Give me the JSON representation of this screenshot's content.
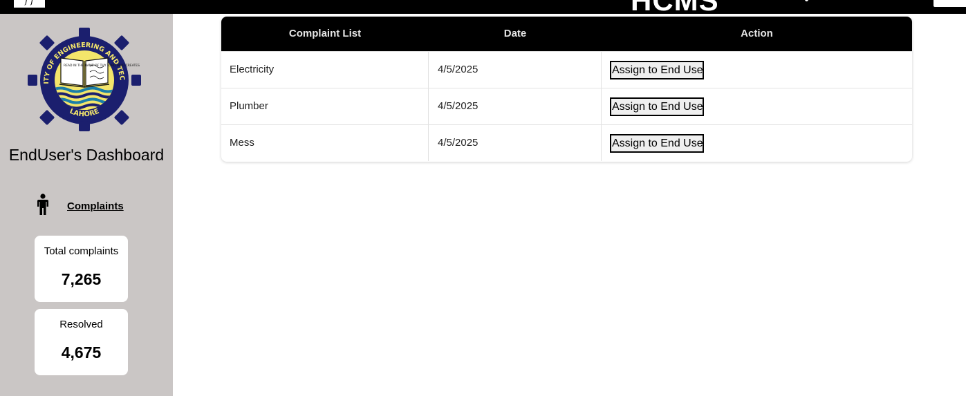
{
  "header": {
    "title": "HCMS",
    "left_mark": "f f"
  },
  "sidebar": {
    "logo": {
      "ring_text": "UNIVERSITY OF ENGINEERING AND TECHNOLOGY",
      "bottom_text": "LAHORE",
      "book_text": "READ IN THE NAME OF THY LORD WHO CREATES"
    },
    "dashboard_title": "EndUser's Dashboard",
    "nav_complaints": "Complaints",
    "stats": [
      {
        "label": "Total complaints",
        "value": "7,265"
      },
      {
        "label": "Resolved",
        "value": "4,675"
      }
    ]
  },
  "table": {
    "columns": [
      "Complaint List",
      "Date",
      "Action"
    ],
    "rows": [
      {
        "complaint": "Electricity",
        "date": "4/5/2025",
        "action": "Assign to End User"
      },
      {
        "complaint": "Plumber",
        "date": "4/5/2025",
        "action": "Assign to End User"
      },
      {
        "complaint": "Mess",
        "date": "4/5/2025",
        "action": "Assign to End User"
      }
    ]
  },
  "colors": {
    "topbar": "#000000",
    "sidebar": "#cac6c5",
    "logo_navy": "#1b1f6e",
    "logo_yellow": "#f3e56b"
  },
  "icons": {
    "nav": "person-icon"
  }
}
